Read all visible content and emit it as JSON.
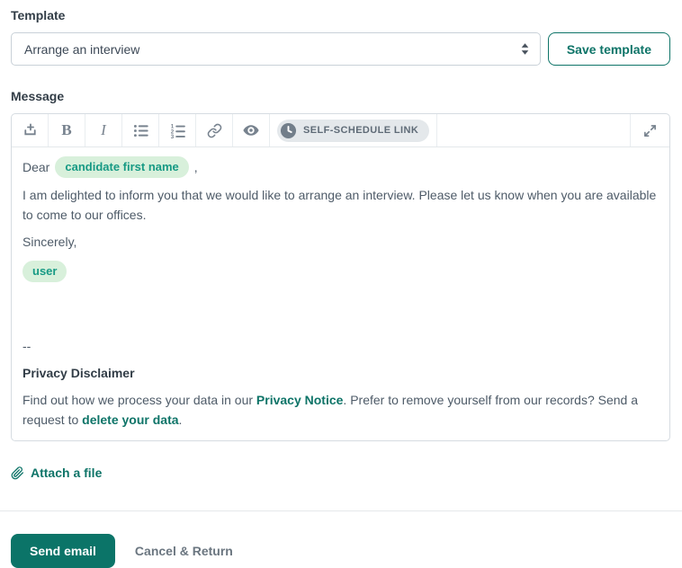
{
  "template_section": {
    "label": "Template",
    "selected_option": "Arrange an interview",
    "save_button": "Save template"
  },
  "message_section": {
    "label": "Message"
  },
  "toolbar": {
    "icons": [
      "insert-merge-tag",
      "bold",
      "italic",
      "bulleted-list",
      "numbered-list",
      "link",
      "preview-eye",
      "self-schedule-link",
      "expand"
    ],
    "bold_glyph": "B",
    "italic_glyph": "I",
    "ol_digits": [
      "1",
      "2",
      "3"
    ],
    "self_schedule_label": "SELF-SCHEDULE LINK"
  },
  "editor": {
    "greeting_prefix": "Dear",
    "greeting_tag": "candidate first name",
    "greeting_suffix": ",",
    "paragraph": "I am delighted to inform you that we would like to arrange an interview. Please let us know when you are available to come to our offices.",
    "closing": "Sincerely,",
    "signature_tag": "user",
    "separator": "--",
    "privacy_heading": "Privacy Disclaimer",
    "privacy_text_1": "Find out how we process your data in our ",
    "privacy_link_1": "Privacy Notice",
    "privacy_text_2": ". Prefer to remove yourself from our records? Send a request to ",
    "privacy_link_2": "delete your data",
    "privacy_text_3": "."
  },
  "attachments": {
    "attach_label": "Attach a file"
  },
  "footer": {
    "send_button": "Send email",
    "cancel_button": "Cancel & Return"
  },
  "colors": {
    "accent_teal": "#0E7468",
    "send_button_bg": "#0B7468",
    "tag_bg": "#D8F0DB",
    "tag_text": "#179A84",
    "toolbar_icon": "#77828E",
    "self_schedule_pill_bg": "#E4E8EB",
    "self_schedule_pill_text": "#5F6B77",
    "input_border": "#C9D1D8",
    "editor_border": "#D6DCE1",
    "divider": "#E5E8EB",
    "body_text": "#4E5B68",
    "heading_text": "#323D47",
    "cancel_text": "#6B7680"
  }
}
